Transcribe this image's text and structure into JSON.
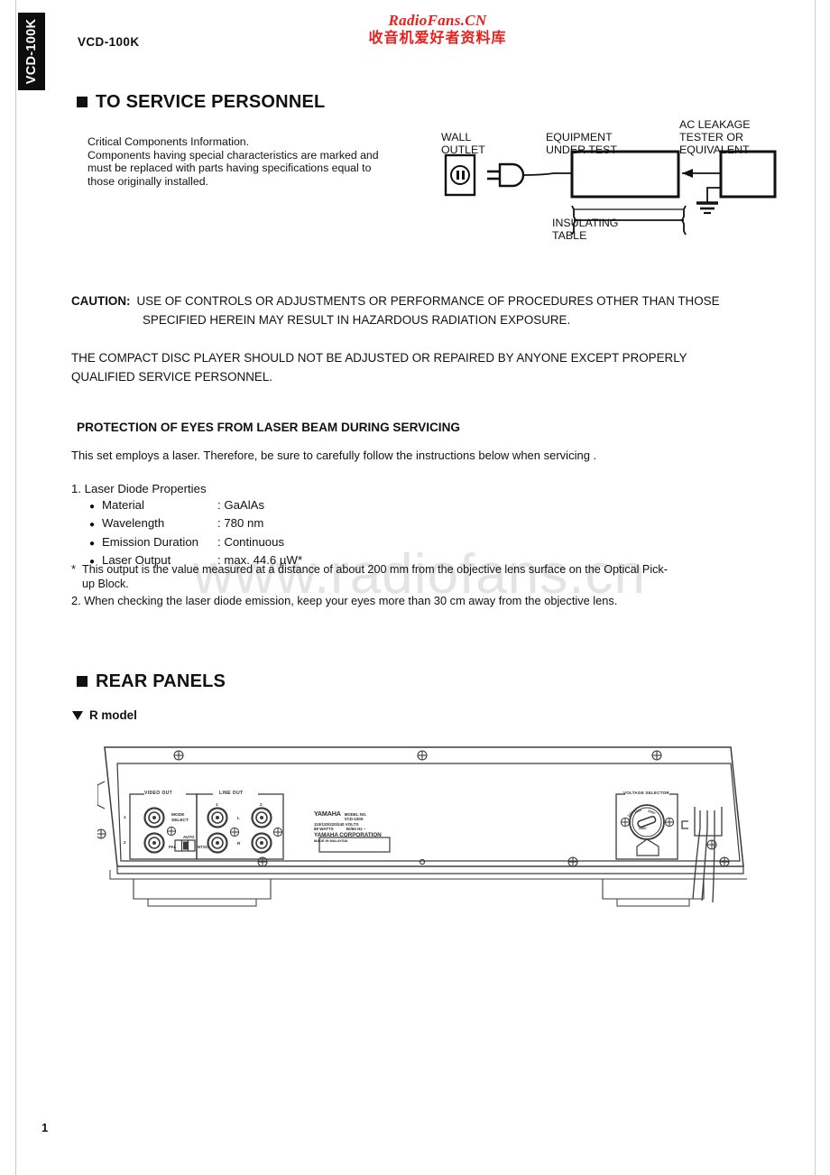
{
  "document": {
    "model": "VCD-100K",
    "side_tab_label": "VCD-100K",
    "page_number": "1"
  },
  "watermarks": {
    "top_line1": "RadioFans.CN",
    "top_line2": "收音机爱好者资料库",
    "top_color": "#e8201d",
    "center": "www.radiofans.cn",
    "center_color": "#e4e4e4"
  },
  "service_section": {
    "heading": "TO SERVICE PERSONNEL",
    "critical_components": {
      "line1": "Critical Components Information.",
      "line2": "Components having special characteristics are marked and",
      "line3": "must be replaced with parts having specifications equal to",
      "line4": "those originally installed."
    },
    "leakage_diagram": {
      "wall_outlet_line1": "WALL",
      "wall_outlet_line2": "OUTLET",
      "equipment_line1": "EQUIPMENT",
      "equipment_line2": "UNDER TEST",
      "tester_line1": "AC LEAKAGE",
      "tester_line2": "TESTER OR",
      "tester_line3": "EQUIVALENT",
      "insulating_line1": "INSULATING",
      "insulating_line2": "TABLE"
    }
  },
  "caution": {
    "label": "CAUTION:",
    "line1": "USE OF CONTROLS OR ADJUSTMENTS OR PERFORMANCE OF PROCEDURES OTHER THAN THOSE",
    "line2": "SPECIFIED HEREIN MAY RESULT IN HAZARDOUS RADIATION EXPOSURE.",
    "para2_line1": "THE COMPACT DISC PLAYER SHOULD NOT BE ADJUSTED OR REPAIRED BY ANYONE EXCEPT PROPERLY",
    "para2_line2": "QUALIFIED SERVICE PERSONNEL."
  },
  "laser": {
    "heading": "PROTECTION OF EYES FROM LASER BEAM DURING SERVICING",
    "intro": "This set employs a laser. Therefore, be sure to carefully follow  the instructions below when servicing .",
    "item1_title": "1. Laser Diode Properties",
    "properties": [
      {
        "key": "Material",
        "value": ": GaAlAs"
      },
      {
        "key": "Wavelength",
        "value": ": 780 nm"
      },
      {
        "key": "Emission Duration",
        "value": ": Continuous"
      },
      {
        "key": "Laser Output",
        "value": ": max. 44.6 µW*"
      }
    ],
    "footnote_line1": "This output is the value measured at a distance of about 200 mm from the objective lens surface on the Optical Pick-",
    "footnote_line2": "up Block.",
    "item2": "2. When checking the laser diode emission, keep your eyes more than 30 cm away from the objective lens."
  },
  "rear_panels": {
    "heading": "REAR PANELS",
    "model_label": "R model",
    "video_out_label": "VIDEO OUT",
    "video_jack_1": "1",
    "video_jack_2": "2",
    "line_out_label": "LINE OUT",
    "line_jack_1": "1",
    "line_jack_2": "2",
    "line_ch_l": "L",
    "line_ch_r": "R",
    "mode_select_line1": "MODE",
    "mode_select_line2": "SELECT",
    "mode_auto": "AUTO",
    "mode_pal": "PAL",
    "mode_ntsc": "NTSC",
    "nameplate": {
      "brand": "YAMAHA",
      "model_no_label": "MODEL NO.",
      "model_no": "VCD-100K",
      "voltage": "110/120/220/240 VOLTS",
      "watts": "89 WATTS",
      "frequency": "50/60 Hz  ~",
      "company": "YAMAHA CORPORATION",
      "origin": "MADE IN MALAYSIA"
    },
    "voltage_selector_label": "VOLTAGE SELECTOR",
    "voltage_options": [
      "110V",
      "120V",
      "220V",
      "240V"
    ]
  }
}
